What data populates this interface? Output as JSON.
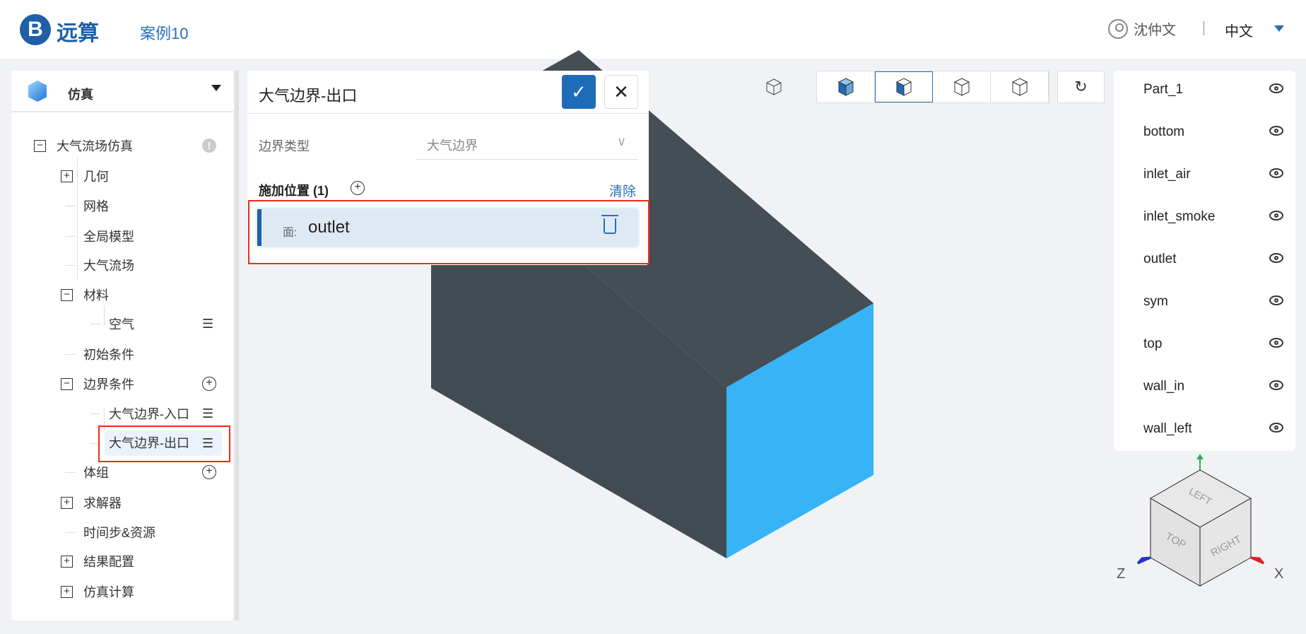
{
  "header": {
    "logo_letter": "B",
    "logo_text": "远算",
    "case_title": "案例10",
    "user": "沈仲文",
    "language": "中文"
  },
  "sidebar": {
    "title": "仿真",
    "tree": [
      {
        "label": "大气流场仿真",
        "level": 0,
        "toggle": "−",
        "action": "warning"
      },
      {
        "label": "几何",
        "level": 1,
        "toggle": "+"
      },
      {
        "label": "网格",
        "level": 1
      },
      {
        "label": "全局模型",
        "level": 1
      },
      {
        "label": "大气流场",
        "level": 1
      },
      {
        "label": "材料",
        "level": 1,
        "toggle": "−"
      },
      {
        "label": "空气",
        "level": 2,
        "action": "menu"
      },
      {
        "label": "初始条件",
        "level": 1
      },
      {
        "label": "边界条件",
        "level": 1,
        "toggle": "−",
        "action": "add"
      },
      {
        "label": "大气边界-入口",
        "level": 2,
        "action": "menu"
      },
      {
        "label": "大气边界-出口",
        "level": 2,
        "action": "menu",
        "selected": true
      },
      {
        "label": "体组",
        "level": 1,
        "action": "add"
      },
      {
        "label": "求解器",
        "level": 1,
        "toggle": "+"
      },
      {
        "label": "时间步&资源",
        "level": 1
      },
      {
        "label": "结果配置",
        "level": 1,
        "toggle": "+"
      },
      {
        "label": "仿真计算",
        "level": 1,
        "toggle": "+"
      }
    ]
  },
  "panel": {
    "title": "大气边界-出口",
    "confirm": "✓",
    "cancel": "✕",
    "type_label": "边界类型",
    "type_value": "大气边界",
    "location_label": "施加位置 (1)",
    "clear": "清除",
    "face_key": "面:",
    "face_value": "outlet"
  },
  "view_toolbar": {
    "icons": [
      "cube-outline-icon",
      "solid-cube-icon",
      "solid-edges-cube-icon",
      "wireframe-cube-icon",
      "points-cube-icon",
      "reset-view-icon"
    ],
    "active": "solid-edges-cube-icon"
  },
  "parts": [
    "Part_1",
    "bottom",
    "inlet_air",
    "inlet_smoke",
    "outlet",
    "sym",
    "top",
    "wall_in",
    "wall_left"
  ],
  "viewcube": {
    "faces": [
      "TOP",
      "RIGHT",
      "LEFT"
    ],
    "axes": [
      "Z",
      "X"
    ]
  },
  "colors": {
    "accent": "#1e6bb8",
    "model_body": "#454d55",
    "selected_face": "#36b4f6",
    "highlight": "#ef2a1a"
  }
}
